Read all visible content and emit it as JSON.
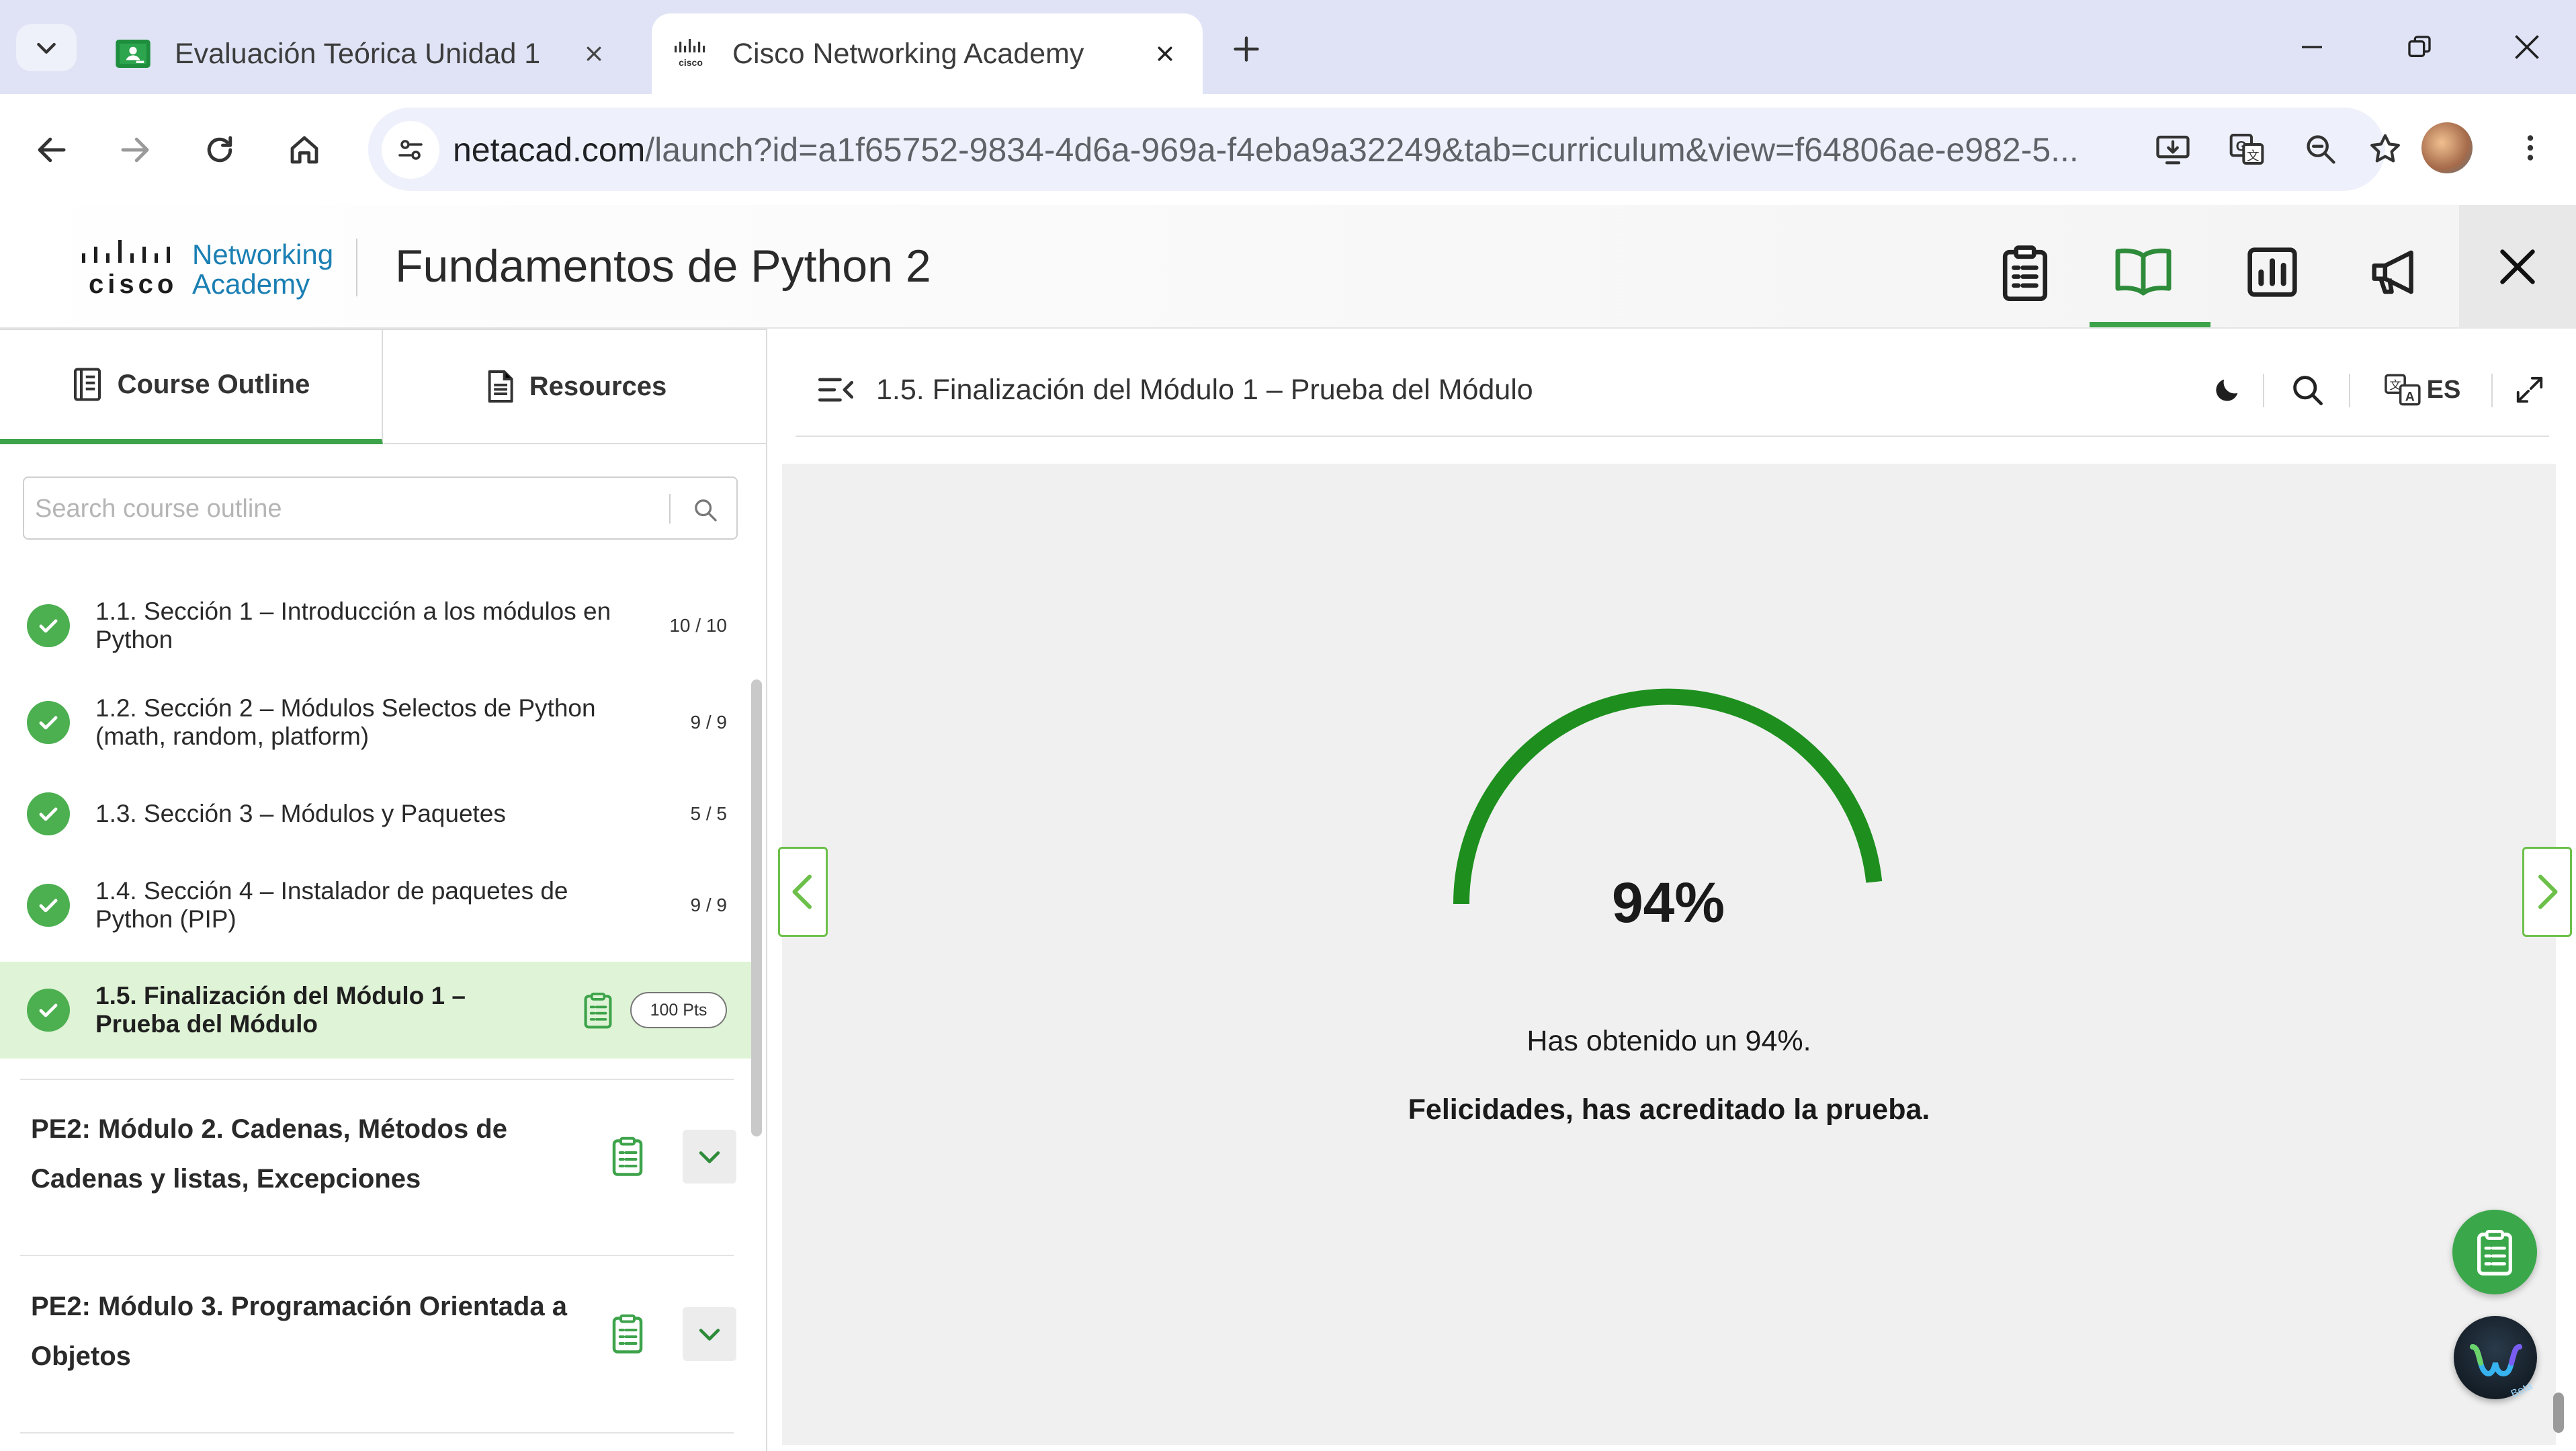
{
  "browser": {
    "tabs": [
      {
        "title": "Evaluación Teórica Unidad 1",
        "active": false
      },
      {
        "title": "Cisco Networking Academy",
        "active": true
      }
    ],
    "url_host": "netacad.com",
    "url_path": "/launch?id=a1f65752-9834-4d6a-969a-f4eba9a32249&tab=curriculum&view=f64806ae-e982-5..."
  },
  "app": {
    "logo_text_1": "Networking",
    "logo_text_2": "Academy",
    "logo_cisco": "cisco",
    "title": "Fundamentos de Python 2",
    "active_nav": "book-icon"
  },
  "sidebar": {
    "tabs": [
      {
        "label": "Course Outline",
        "active": true
      },
      {
        "label": "Resources",
        "active": false
      }
    ],
    "search_placeholder": "Search course outline",
    "items": [
      {
        "label": "1.1. Sección 1 – Introducción a los módulos en Python",
        "count": "10 / 10",
        "completed": true
      },
      {
        "label": "1.2. Sección 2 – Módulos Selectos de Python (math, random, platform)",
        "count": "9 / 9",
        "completed": true
      },
      {
        "label": "1.3. Sección 3 – Módulos y Paquetes",
        "count": "5 / 5",
        "completed": true
      },
      {
        "label": "1.4. Sección 4 – Instalador de paquetes de Python (PIP)",
        "count": "9 / 9",
        "completed": true
      },
      {
        "label": "1.5. Finalización del Módulo 1 – Prueba del Módulo",
        "badge": "100 Pts",
        "completed": true,
        "current": true
      }
    ],
    "modules": [
      {
        "title": "PE2: Módulo 2. Cadenas, Métodos de Cadenas y listas, Excepciones"
      },
      {
        "title": "PE2: Módulo 3. Programación Orientada a Objetos"
      }
    ]
  },
  "content": {
    "title": "1.5. Finalización del Módulo 1 – Prueba del Módulo",
    "language": "ES",
    "score_percent": 94,
    "score_label": "94%",
    "message": "Has obtenido un 94%.",
    "pass_message": "Felicidades, has acreditado la prueba.",
    "gauge_color": "#1e8f1e",
    "gauge_track_color": "#f0f0f0"
  },
  "floating": {
    "webex_badge": "Beta"
  },
  "colors": {
    "accent": "#3da34a",
    "current_item_bg": "#dff3d6",
    "tabstrip": "#dfe3f5"
  }
}
